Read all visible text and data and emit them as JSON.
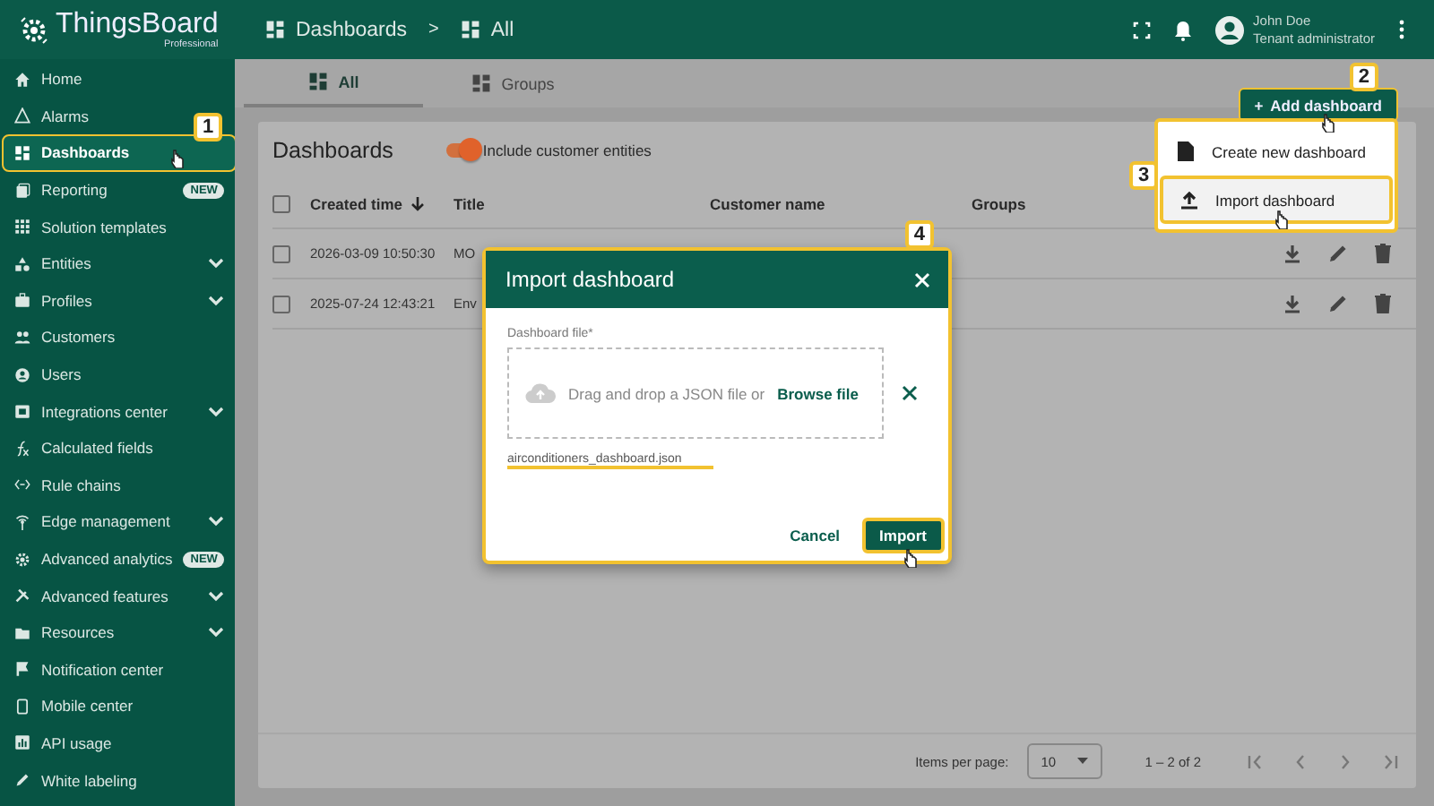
{
  "topbar": {
    "logo": "ThingsBoard",
    "edition": "Professional",
    "breadcrumb": [
      {
        "label": "Dashboards"
      },
      {
        "label": "All"
      }
    ],
    "separator": ">",
    "user": {
      "name": "John Doe",
      "role": "Tenant administrator"
    }
  },
  "sidebar": {
    "items": [
      {
        "label": "Home",
        "selected": false,
        "expandable": false
      },
      {
        "label": "Alarms",
        "selected": false,
        "expandable": false
      },
      {
        "label": "Dashboards",
        "selected": true,
        "expandable": false,
        "callout": "1"
      },
      {
        "label": "Reporting",
        "selected": false,
        "expandable": false,
        "badge": "NEW"
      },
      {
        "label": "Solution templates",
        "selected": false,
        "expandable": false
      },
      {
        "label": "Entities",
        "selected": false,
        "expandable": true
      },
      {
        "label": "Profiles",
        "selected": false,
        "expandable": true
      },
      {
        "label": "Customers",
        "selected": false,
        "expandable": false
      },
      {
        "label": "Users",
        "selected": false,
        "expandable": false
      },
      {
        "label": "Integrations center",
        "selected": false,
        "expandable": true
      },
      {
        "label": "Calculated fields",
        "selected": false,
        "expandable": false
      },
      {
        "label": "Rule chains",
        "selected": false,
        "expandable": false
      },
      {
        "label": "Edge management",
        "selected": false,
        "expandable": true
      },
      {
        "label": "Advanced analytics",
        "selected": false,
        "expandable": false,
        "badge": "NEW"
      },
      {
        "label": "Advanced features",
        "selected": false,
        "expandable": true
      },
      {
        "label": "Resources",
        "selected": false,
        "expandable": true
      },
      {
        "label": "Notification center",
        "selected": false,
        "expandable": false
      },
      {
        "label": "Mobile center",
        "selected": false,
        "expandable": false
      },
      {
        "label": "API usage",
        "selected": false,
        "expandable": false
      },
      {
        "label": "White labeling",
        "selected": false,
        "expandable": false
      }
    ]
  },
  "tabs": [
    {
      "label": "All",
      "selected": true
    },
    {
      "label": "Groups",
      "selected": false
    }
  ],
  "add_button": {
    "label": "Add dashboard",
    "icon_text": "+",
    "callout": "2"
  },
  "add_menu": {
    "items": [
      {
        "label": "Create new dashboard",
        "highlighted": false
      },
      {
        "label": "Import dashboard",
        "highlighted": true,
        "callout": "3"
      }
    ]
  },
  "card": {
    "title": "Dashboards",
    "toggle": {
      "label": "Include customer entities",
      "on": true
    },
    "table": {
      "all_checked": false,
      "columns": [
        {
          "label": "Created time",
          "sorted": true
        },
        {
          "label": "Title",
          "sorted": false
        },
        {
          "label": "Customer name",
          "sorted": false
        },
        {
          "label": "Groups",
          "sorted": false
        }
      ],
      "rows": [
        {
          "created_time": "2026-03-09 10:50:30",
          "title": "MO",
          "checked": false
        },
        {
          "created_time": "2025-07-24 12:43:21",
          "title": "Env",
          "checked": false
        }
      ]
    },
    "paginator": {
      "label": "Items per page:",
      "page_size": "10",
      "range": "1 – 2 of 2"
    }
  },
  "dialog": {
    "title": "Import dashboard",
    "callout": "4",
    "field_label": "Dashboard file*",
    "drop_text": "Drag and drop a JSON file or",
    "browse": "Browse file",
    "file_name": "airconditioners_dashboard.json",
    "buttons": [
      {
        "label": "Cancel",
        "kind": "text",
        "highlighted": false
      },
      {
        "label": "Import",
        "kind": "primary",
        "highlighted": true
      }
    ]
  }
}
